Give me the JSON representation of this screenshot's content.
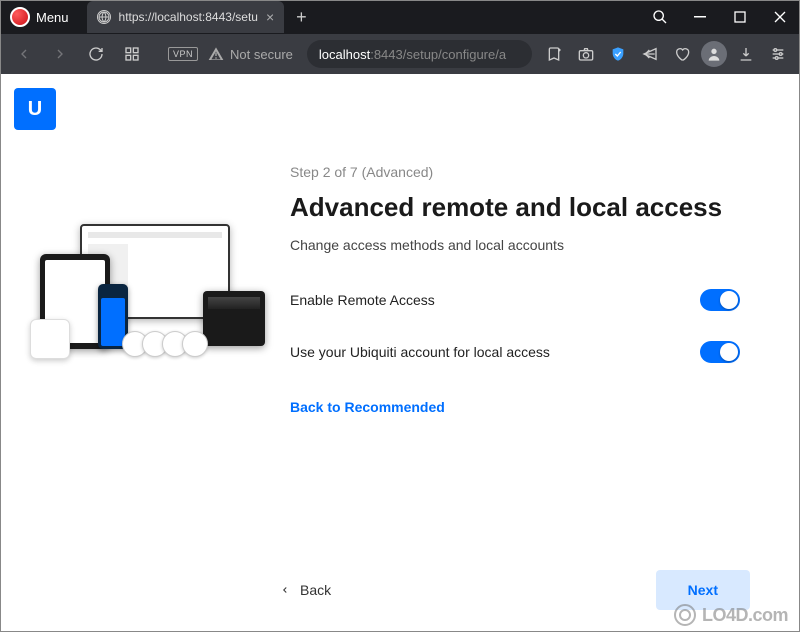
{
  "browser": {
    "menu_label": "Menu",
    "tab_title": "https://localhost:8443/setu",
    "address_host": "localhost",
    "address_port_path": ":8443/setup/configure/a",
    "vpn_badge": "VPN",
    "not_secure": "Not secure"
  },
  "app": {
    "logo_letter": "U"
  },
  "setup": {
    "step_label": "Step 2 of 7 (Advanced)",
    "heading": "Advanced remote and local access",
    "subtitle": "Change access methods and local accounts",
    "settings": [
      {
        "label": "Enable Remote Access",
        "enabled": true
      },
      {
        "label": "Use your Ubiquiti account for local access",
        "enabled": true
      }
    ],
    "back_to_recommended": "Back to Recommended",
    "back_label": "Back",
    "next_label": "Next"
  },
  "watermark": "LO4D.com"
}
